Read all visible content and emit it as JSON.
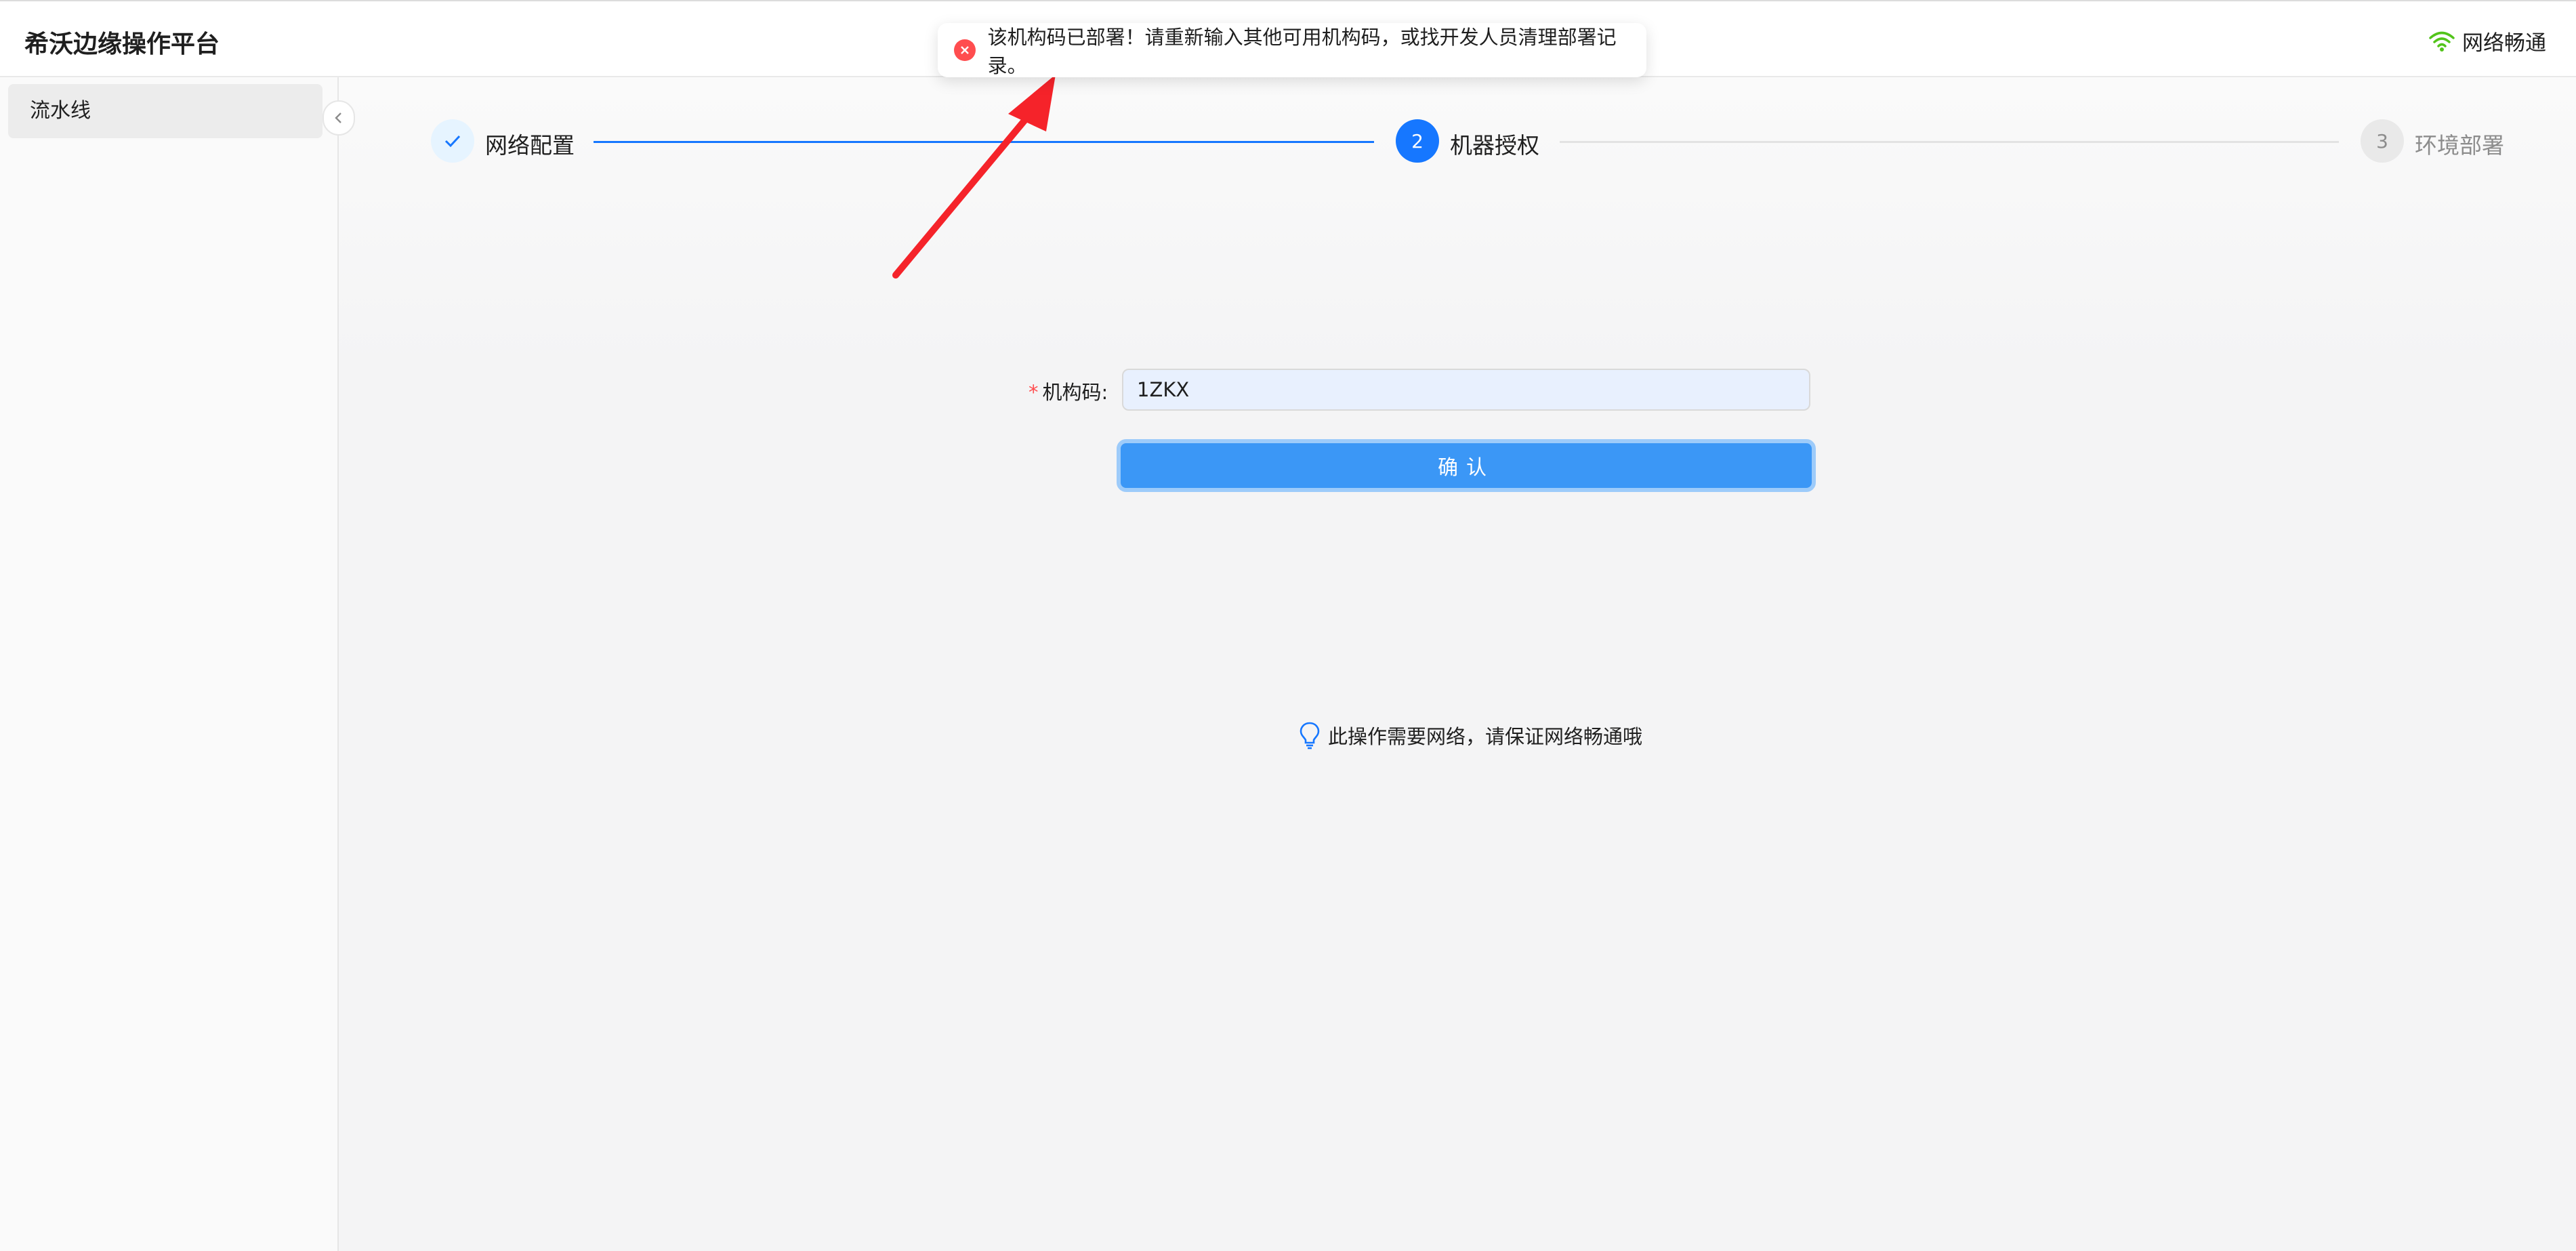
{
  "app": {
    "title": "希沃边缘操作平台"
  },
  "header": {
    "network_status": "网络畅通",
    "network_icon": "wifi-icon",
    "network_color": "#52c41a"
  },
  "sidebar": {
    "items": [
      {
        "label": "流水线",
        "active": true
      }
    ],
    "collapse_icon": "chevron-left-icon"
  },
  "steps": [
    {
      "number": "1",
      "label": "网络配置",
      "status": "finished",
      "icon": "check-icon"
    },
    {
      "number": "2",
      "label": "机器授权",
      "status": "current"
    },
    {
      "number": "3",
      "label": "环境部署",
      "status": "waiting"
    }
  ],
  "form": {
    "required_mark": "*",
    "machine_code_label": "机构码:",
    "machine_code_value": "1ZKX",
    "confirm_label": "确认"
  },
  "hint": {
    "text": "此操作需要网络，请保证网络畅通哦",
    "icon": "lightbulb-icon"
  },
  "toast": {
    "type": "error",
    "icon": "error-circle-icon",
    "message": "该机构码已部署！请重新输入其他可用机构码，或找开发人员清理部署记录。"
  },
  "colors": {
    "primary": "#1677ff",
    "error": "#ff4d4f",
    "annotation_arrow": "#f5232a"
  }
}
